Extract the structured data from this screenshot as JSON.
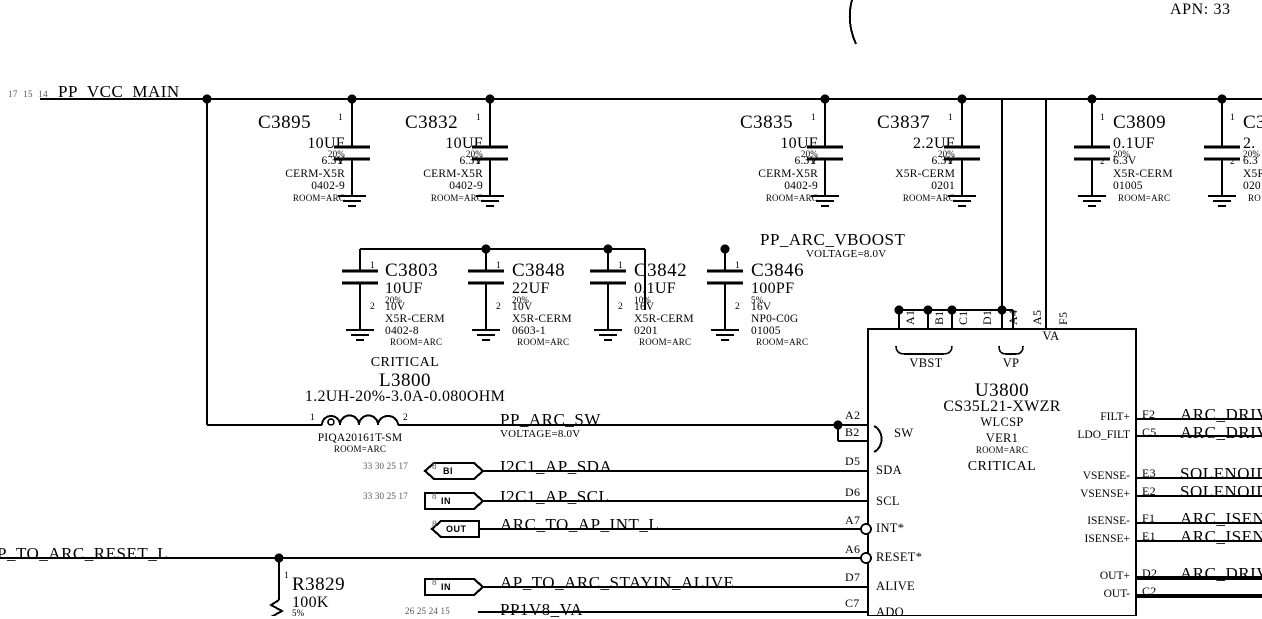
{
  "sheet": {
    "apn": "APN: 33",
    "title_net": "PP_VCC_MAIN",
    "left_sheet_refs_vcc": [
      "17",
      "15",
      "14"
    ]
  },
  "nets": {
    "vcc_main": "PP_VCC_MAIN",
    "arc_vboost": "PP_ARC_VBOOST",
    "arc_vboost_voltage": "VOLTAGE=8.0V",
    "arc_sw": "PP_ARC_SW",
    "arc_sw_voltage": "VOLTAGE=8.0V",
    "reset_l": "P_TO_ARC_RESET_L"
  },
  "capacitors_top": [
    {
      "refdes": "C3895",
      "value": "10UF",
      "tol": "20%",
      "volt": "6.3V",
      "diel": "CERM-X5R",
      "pkg": "0402-9",
      "room": "ROOM=ARC",
      "pin1": "1",
      "pin2": "2"
    },
    {
      "refdes": "C3832",
      "value": "10UF",
      "tol": "20%",
      "volt": "6.3V",
      "diel": "CERM-X5R",
      "pkg": "0402-9",
      "room": "ROOM=ARC",
      "pin1": "1",
      "pin2": "2"
    },
    {
      "refdes": "C3835",
      "value": "10UF",
      "tol": "20%",
      "volt": "6.3V",
      "diel": "CERM-X5R",
      "pkg": "0402-9",
      "room": "ROOM=ARC",
      "pin1": "1",
      "pin2": "2"
    },
    {
      "refdes": "C3837",
      "value": "2.2UF",
      "tol": "20%",
      "volt": "6.3V",
      "diel": "X5R-CERM",
      "pkg": "0201",
      "room": "ROOM=ARC",
      "pin1": "1",
      "pin2": "2"
    },
    {
      "refdes": "C3809",
      "value": "0.1UF",
      "tol": "20%",
      "volt": "6.3V",
      "diel": "X5R-CERM",
      "pkg": "01005",
      "room": "ROOM=ARC",
      "pin1": "1",
      "pin2": "2"
    },
    {
      "refdes": "C3",
      "value": "2.",
      "tol": "20%",
      "volt": "6.3",
      "diel": "X5R",
      "pkg": "020",
      "room": "RO",
      "pin1": "1",
      "pin2": "2"
    }
  ],
  "capacitors_mid": [
    {
      "refdes": "C3803",
      "value": "10UF",
      "tol": "20%",
      "volt": "10V",
      "diel": "X5R-CERM",
      "pkg": "0402-8",
      "room": "ROOM=ARC",
      "pin1": "1",
      "pin2": "2"
    },
    {
      "refdes": "C3848",
      "value": "22UF",
      "tol": "20%",
      "volt": "10V",
      "diel": "X5R-CERM",
      "pkg": "0603-1",
      "room": "ROOM=ARC",
      "pin1": "1",
      "pin2": "2"
    },
    {
      "refdes": "C3842",
      "value": "0.1UF",
      "tol": "10%",
      "volt": "16V",
      "diel": "X5R-CERM",
      "pkg": "0201",
      "room": "ROOM=ARC",
      "pin1": "1",
      "pin2": "2"
    },
    {
      "refdes": "C3846",
      "value": "100PF",
      "tol": "5%",
      "volt": "16V",
      "diel": "NP0-C0G",
      "pkg": "01005",
      "room": "ROOM=ARC",
      "pin1": "1",
      "pin2": "2"
    }
  ],
  "inductor": {
    "critical": "CRITICAL",
    "refdes": "L3800",
    "value": "1.2UH-20%-3.0A-0.080OHM",
    "partnum": "PIQA20161T-SM",
    "room": "ROOM=ARC",
    "pin1": "1",
    "pin2": "2"
  },
  "resistor": {
    "refdes": "R3829",
    "value": "100K",
    "tol": "5%",
    "pin1": "1"
  },
  "ic": {
    "refdes": "U3800",
    "part": "CS35L21-XWZR",
    "package": "WLCSP",
    "version": "VER1",
    "room": "ROOM=ARC",
    "critical": "CRITICAL",
    "top_pins": [
      {
        "num": "A1",
        "group": "VBST"
      },
      {
        "num": "B1",
        "group": "VBST"
      },
      {
        "num": "C1",
        "group": "VBST"
      },
      {
        "num": "D1",
        "group": "VBST"
      },
      {
        "num": "A4",
        "group": "VP"
      },
      {
        "num": "A5",
        "group": "VP"
      },
      {
        "num": "F5",
        "group": "VA"
      }
    ],
    "top_groups": [
      "VBST",
      "VP",
      "VA"
    ],
    "left_pins": [
      {
        "num": "A2",
        "fn": "SW",
        "net": "PP_ARC_SW",
        "bubble": false
      },
      {
        "num": "B2",
        "fn": "",
        "net": "",
        "bubble": false
      },
      {
        "num": "D5",
        "fn": "SDA",
        "net": "I2C1_AP_SDA",
        "bubble": false
      },
      {
        "num": "D6",
        "fn": "SCL",
        "net": "I2C1_AP_SCL",
        "bubble": false
      },
      {
        "num": "A7",
        "fn": "INT*",
        "net": "ARC_TO_AP_INT_L",
        "bubble": true
      },
      {
        "num": "A6",
        "fn": "RESET*",
        "net": "",
        "bubble": true
      },
      {
        "num": "D7",
        "fn": "ALIVE",
        "net": "AP_TO_ARC_STAYIN_ALIVE",
        "bubble": false
      },
      {
        "num": "C7",
        "fn": "ADO",
        "net": "PP1V8_VA",
        "bubble": false
      }
    ],
    "right_pins": [
      {
        "fn": "FILT+",
        "num": "F2",
        "net": "ARC_DRIV"
      },
      {
        "fn": "LDO_FILT",
        "num": "C5",
        "net": "ARC_DRIV"
      },
      {
        "fn": "VSENSE-",
        "num": "E3",
        "net": "SOLENOID_"
      },
      {
        "fn": "VSENSE+",
        "num": "E2",
        "net": "SOLENOID_"
      },
      {
        "fn": "ISENSE-",
        "num": "F1",
        "net": "ARC_ISEN"
      },
      {
        "fn": "ISENSE+",
        "num": "E1",
        "net": "ARC_ISEN"
      },
      {
        "fn": "OUT+",
        "num": "D2",
        "net": "ARC_DRIV"
      },
      {
        "fn": "OUT-",
        "num": "C2",
        "net": ""
      }
    ]
  },
  "signal_tags": [
    {
      "kind": "BI",
      "net": "I2C1_AP_SDA",
      "refs": "33  30  25  17",
      "sheet": "8"
    },
    {
      "kind": "IN",
      "net": "I2C1_AP_SCL",
      "refs": "33  30  25  17",
      "sheet": "8"
    },
    {
      "kind": "OUT",
      "net": "ARC_TO_AP_INT_L",
      "refs": "",
      "sheet": "8"
    },
    {
      "kind": "IN",
      "net": "AP_TO_ARC_STAYIN_ALIVE",
      "refs": "",
      "sheet": "8"
    },
    {
      "kind": "",
      "net": "PP1V8_VA",
      "refs": "26  25  24  15",
      "sheet": ""
    }
  ],
  "colors": {
    "wire": "#000000",
    "background": "#ffffff",
    "text": "#000000",
    "dim_text": "#555555"
  }
}
